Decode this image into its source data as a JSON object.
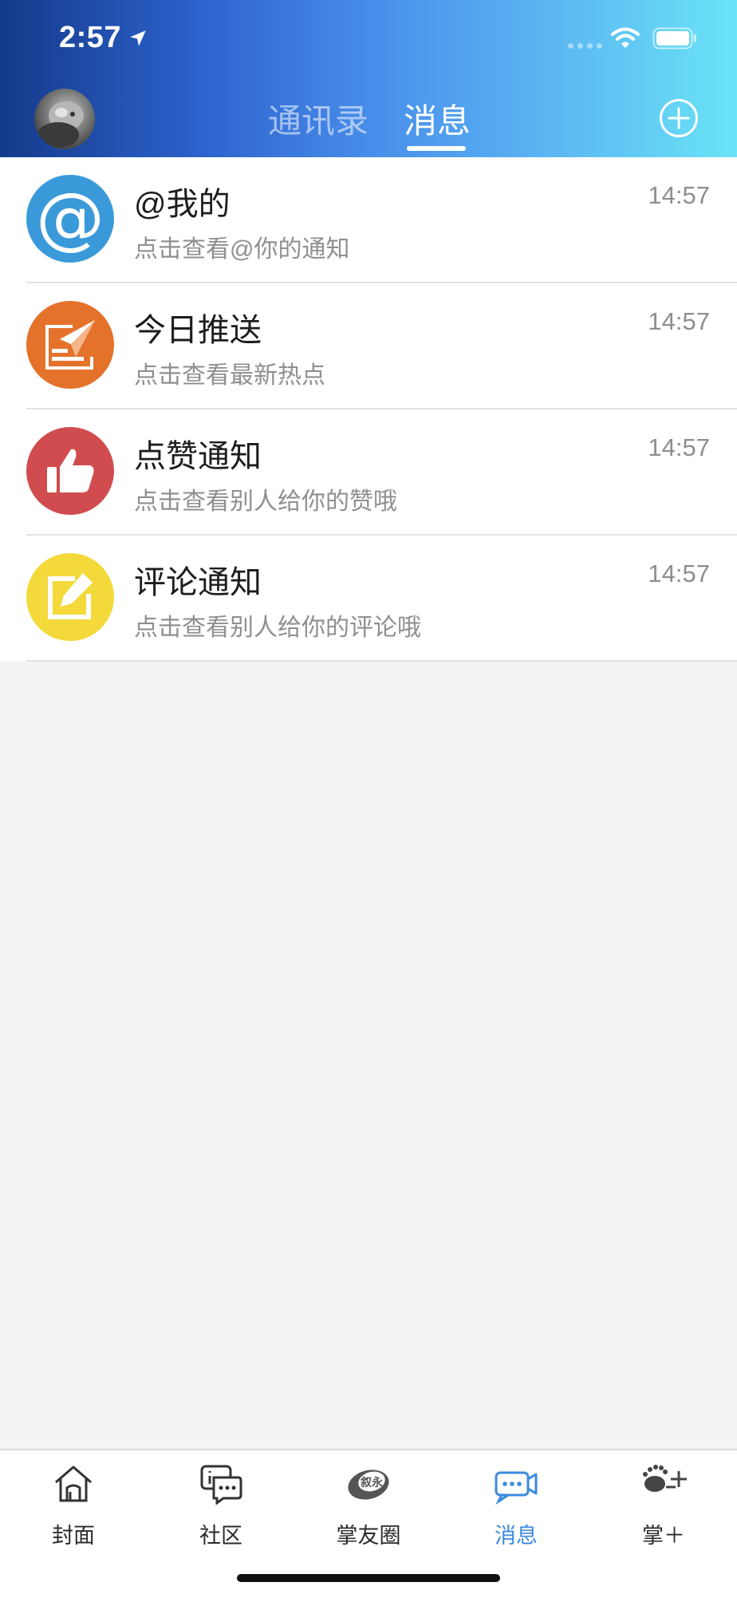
{
  "status_bar": {
    "time": "2:57"
  },
  "header": {
    "tabs": [
      {
        "label": "通讯录",
        "active": false
      },
      {
        "label": "消息",
        "active": true
      }
    ]
  },
  "messages": [
    {
      "title": "@我的",
      "subtitle": "点击查看@你的通知",
      "time": "14:57",
      "icon": "at-icon",
      "color": "#3a9ad9"
    },
    {
      "title": "今日推送",
      "subtitle": "点击查看最新热点",
      "time": "14:57",
      "icon": "paper-plane-icon",
      "color": "#e4722b"
    },
    {
      "title": "点赞通知",
      "subtitle": "点击查看别人给你的赞哦",
      "time": "14:57",
      "icon": "thumbs-up-icon",
      "color": "#d04c4f"
    },
    {
      "title": "评论通知",
      "subtitle": "点击查看别人给你的评论哦",
      "time": "14:57",
      "icon": "edit-icon",
      "color": "#f4d93a"
    }
  ],
  "tabbar": {
    "items": [
      {
        "label": "封面",
        "icon": "home-icon",
        "active": false
      },
      {
        "label": "社区",
        "icon": "community-chat-icon",
        "active": false
      },
      {
        "label": "掌友圈",
        "icon": "circle-logo-icon",
        "active": false
      },
      {
        "label": "消息",
        "icon": "message-icon",
        "active": true
      },
      {
        "label": "掌＋",
        "icon": "plus-app-icon",
        "active": false
      }
    ],
    "active_color": "#3b8be1"
  },
  "circle_logo_text": "叙永"
}
